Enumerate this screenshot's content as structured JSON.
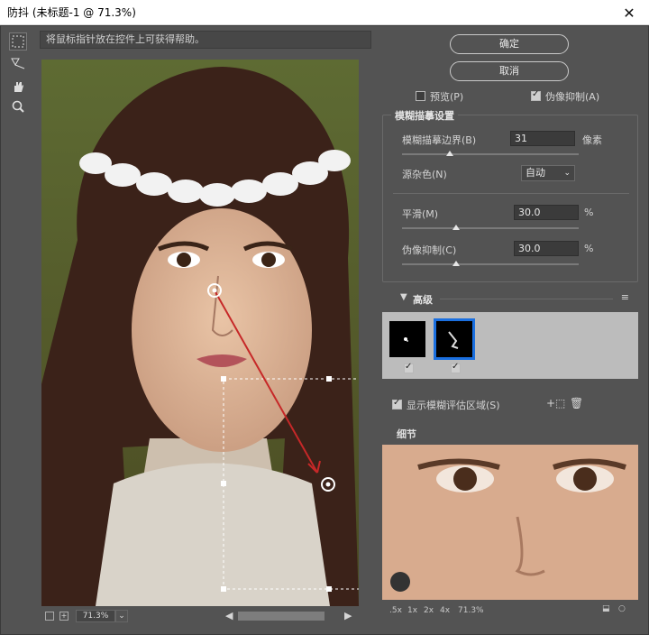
{
  "window": {
    "title": "防抖 (未标题-1 @ 71.3%)",
    "close_glyph": "✕"
  },
  "hint": "将鼠标指针放在控件上可获得帮助。",
  "tools": [
    {
      "name": "marquee-icon",
      "glyph": "⬚"
    },
    {
      "name": "blur-trace-icon",
      "glyph": "⟋"
    },
    {
      "name": "hand-icon",
      "glyph": "✋"
    },
    {
      "name": "zoom-icon",
      "glyph": "🔍"
    }
  ],
  "buttons": {
    "ok": "确定",
    "cancel": "取消"
  },
  "options": {
    "preview_label": "预览(P)",
    "preview_checked": false,
    "artifact_label": "伪像抑制(A)",
    "artifact_checked": true
  },
  "blur_trace": {
    "title": "模糊描摹设置",
    "bounds_label": "模糊描摹边界(B)",
    "bounds_value": "31",
    "bounds_unit": "像素",
    "bounds_level": 0.22,
    "noise_label": "源杂色(N)",
    "noise_value": "自动",
    "smooth_label": "平滑(M)",
    "smooth_value": "30.0",
    "smooth_unit": "%",
    "smooth_level": 0.3,
    "artifact_label": "伪像抑制(C)",
    "artifact_value": "30.0",
    "artifact_unit": "%",
    "artifact_level": 0.3
  },
  "advanced": {
    "title": "高级",
    "show_region_label": "显示模糊评估区域(S)",
    "show_region_checked": true,
    "kernel1_checked": true,
    "kernel2_checked": true
  },
  "detail": {
    "title": "细节"
  },
  "zoom_options": [
    ".5x",
    "1x",
    "2x",
    "4x",
    "71.3%"
  ],
  "bottom": {
    "zoom": "71.3%"
  },
  "colors": {
    "bg": "#535353",
    "accent": "#1a6fe0",
    "arrow": "#c62828"
  }
}
